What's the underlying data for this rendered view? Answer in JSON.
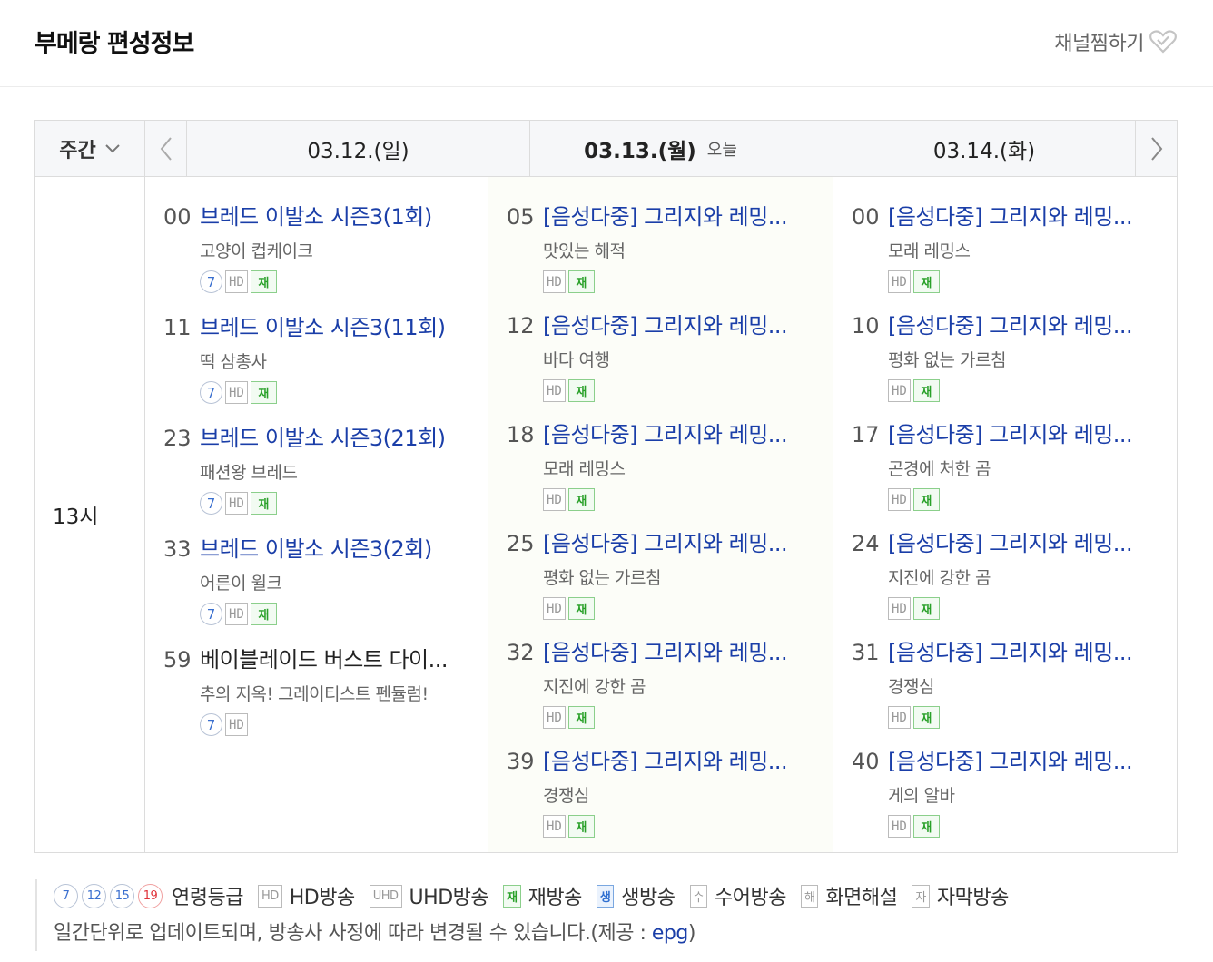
{
  "header": {
    "title": "부메랑 편성정보",
    "favorite_label": "채널찜하기"
  },
  "table": {
    "week_label": "주간",
    "hour_label": "13시",
    "days": [
      {
        "date": "03.12.(일)",
        "today_label": ""
      },
      {
        "date": "03.13.(월)",
        "today_label": "오늘"
      },
      {
        "date": "03.14.(화)",
        "today_label": ""
      }
    ],
    "columns": [
      [
        {
          "minute": "00",
          "title": "브레드 이발소 시즌3(1회)",
          "subtitle": "고양이 컵케이크",
          "age": "7",
          "hd": "HD",
          "rerun": "재"
        },
        {
          "minute": "11",
          "title": "브레드 이발소 시즌3(11회)",
          "subtitle": "떡 삼총사",
          "age": "7",
          "hd": "HD",
          "rerun": "재"
        },
        {
          "minute": "23",
          "title": "브레드 이발소 시즌3(21회)",
          "subtitle": "패션왕 브레드",
          "age": "7",
          "hd": "HD",
          "rerun": "재"
        },
        {
          "minute": "33",
          "title": "브레드 이발소 시즌3(2회)",
          "subtitle": "어른이 윌크",
          "age": "7",
          "hd": "HD",
          "rerun": "재"
        },
        {
          "minute": "59",
          "title": "베이블레이드 버스트 다이...",
          "subtitle": "추의 지옥! 그레이티스트 펜듈럼!",
          "age": "7",
          "hd": "HD",
          "rerun": ""
        }
      ],
      [
        {
          "minute": "05",
          "title": "[음성다중] 그리지와 레밍...",
          "subtitle": "맛있는 해적",
          "age": "",
          "hd": "HD",
          "rerun": "재"
        },
        {
          "minute": "12",
          "title": "[음성다중] 그리지와 레밍...",
          "subtitle": "바다 여행",
          "age": "",
          "hd": "HD",
          "rerun": "재"
        },
        {
          "minute": "18",
          "title": "[음성다중] 그리지와 레밍...",
          "subtitle": "모래 레밍스",
          "age": "",
          "hd": "HD",
          "rerun": "재"
        },
        {
          "minute": "25",
          "title": "[음성다중] 그리지와 레밍...",
          "subtitle": "평화 없는 가르침",
          "age": "",
          "hd": "HD",
          "rerun": "재"
        },
        {
          "minute": "32",
          "title": "[음성다중] 그리지와 레밍...",
          "subtitle": "지진에 강한 곰",
          "age": "",
          "hd": "HD",
          "rerun": "재"
        },
        {
          "minute": "39",
          "title": "[음성다중] 그리지와 레밍...",
          "subtitle": "경쟁심",
          "age": "",
          "hd": "HD",
          "rerun": "재"
        }
      ],
      [
        {
          "minute": "00",
          "title": "[음성다중] 그리지와 레밍...",
          "subtitle": "모래 레밍스",
          "age": "",
          "hd": "HD",
          "rerun": "재"
        },
        {
          "minute": "10",
          "title": "[음성다중] 그리지와 레밍...",
          "subtitle": "평화 없는 가르침",
          "age": "",
          "hd": "HD",
          "rerun": "재"
        },
        {
          "minute": "17",
          "title": "[음성다중] 그리지와 레밍...",
          "subtitle": "곤경에 처한 곰",
          "age": "",
          "hd": "HD",
          "rerun": "재"
        },
        {
          "minute": "24",
          "title": "[음성다중] 그리지와 레밍...",
          "subtitle": "지진에 강한 곰",
          "age": "",
          "hd": "HD",
          "rerun": "재"
        },
        {
          "minute": "31",
          "title": "[음성다중] 그리지와 레밍...",
          "subtitle": "경쟁심",
          "age": "",
          "hd": "HD",
          "rerun": "재"
        },
        {
          "minute": "40",
          "title": "[음성다중] 그리지와 레밍...",
          "subtitle": "게의 알바",
          "age": "",
          "hd": "HD",
          "rerun": "재"
        }
      ]
    ]
  },
  "legend": {
    "ages": [
      {
        "value": "7",
        "color": "#3a6fcf"
      },
      {
        "value": "12",
        "color": "#3a6fcf"
      },
      {
        "value": "15",
        "color": "#3a6fcf"
      },
      {
        "value": "19",
        "color": "#e0333a"
      }
    ],
    "age_label": "연령등급",
    "items": [
      {
        "badge": "HD",
        "label": "HD방송",
        "kind": "plain"
      },
      {
        "badge": "UHD",
        "label": "UHD방송",
        "kind": "plain"
      },
      {
        "badge": "재",
        "label": "재방송",
        "kind": "re"
      },
      {
        "badge": "생",
        "label": "생방송",
        "kind": "live"
      },
      {
        "badge": "수",
        "label": "수어방송",
        "kind": "plain"
      },
      {
        "badge": "해",
        "label": "화면해설",
        "kind": "plain"
      },
      {
        "badge": "자",
        "label": "자막방송",
        "kind": "plain"
      }
    ],
    "note_prefix": "일간단위로 업데이트되며, 방송사 사정에 따라 변경될 수 있습니다.(제공 : ",
    "note_link": "epg",
    "note_suffix": ")"
  }
}
